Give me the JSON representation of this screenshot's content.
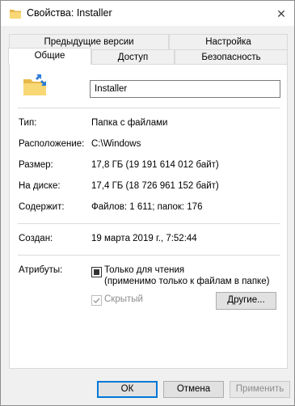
{
  "window": {
    "title": "Свойства: Installer",
    "icon": "folder-icon",
    "close_label": "✕"
  },
  "tabs": {
    "row_back": [
      {
        "label": "Предыдущие версии"
      },
      {
        "label": "Настройка"
      }
    ],
    "row_front": [
      {
        "label": "Общие",
        "active": true
      },
      {
        "label": "Доступ"
      },
      {
        "label": "Безопасность"
      }
    ]
  },
  "general": {
    "name_value": "Installer",
    "fields": [
      {
        "label": "Тип:",
        "value": "Папка с файлами"
      },
      {
        "label": "Расположение:",
        "value": "C:\\Windows"
      },
      {
        "label": "Размер:",
        "value": "17,8 ГБ (19 191 614 012 байт)"
      },
      {
        "label": "На диске:",
        "value": "17,4 ГБ (18 726 961 152 байт)"
      },
      {
        "label": "Содержит:",
        "value": "Файлов: 1 611; папок: 176"
      },
      {
        "label": "Создан:",
        "value": "19 марта 2019 г., 7:52:44"
      }
    ],
    "attributes": {
      "label": "Атрибуты:",
      "readonly_line1": "Только для чтения",
      "readonly_line2": "(применимо только к файлам в папке)",
      "readonly_state": "indeterminate",
      "hidden_label": "Скрытый",
      "hidden_checked": true,
      "hidden_disabled": true,
      "other_button": "Другие..."
    }
  },
  "footer": {
    "ok": "ОК",
    "cancel": "Отмена",
    "apply": "Применить"
  },
  "colors": {
    "window_bg": "#f0f0f0",
    "panel_bg": "#ffffff",
    "accent": "#0078d7",
    "folder_yellow": "#f8d775",
    "arrow_blue": "#2b7bd6"
  }
}
